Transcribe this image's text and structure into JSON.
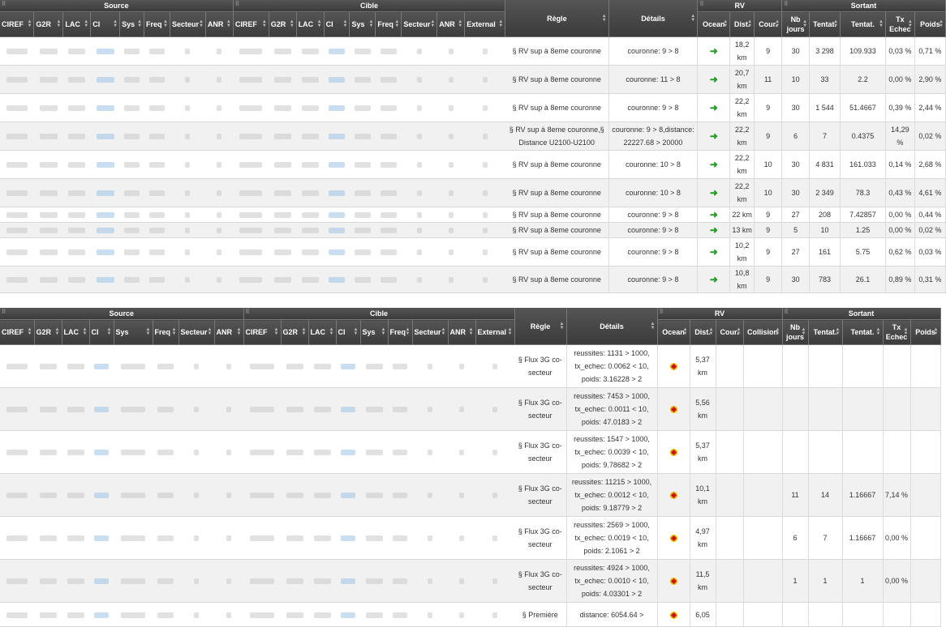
{
  "panel1": {
    "groups": {
      "source": "Source",
      "cible": "Cible",
      "rv": "RV",
      "sortant": "Sortant"
    },
    "cols": {
      "source": [
        "CIREF",
        "G2R",
        "LAC",
        "CI",
        "Sys",
        "Freq",
        "Secteur",
        "ANR"
      ],
      "cible": [
        "CIREF",
        "G2R",
        "LAC",
        "CI",
        "Sys",
        "Freq",
        "Secteur",
        "ANR",
        "External"
      ],
      "regle": "Règle",
      "details": "Détails",
      "rv": [
        "Ocean",
        "Dist.",
        "Cour."
      ],
      "sortant": [
        "Nb jours",
        "Tentat.",
        "Tentat.",
        "Tx Echec",
        "Poids"
      ]
    },
    "rows": [
      {
        "regle": "§ RV sup à 8eme couronne",
        "details": "couronne: 9 > 8",
        "dist": "18,2 km",
        "cour": "9",
        "nb": "30",
        "t1": "3 298",
        "t2": "109.933",
        "tx": "0,03 %",
        "poids": "0,71 %"
      },
      {
        "regle": "§ RV sup à 8eme couronne",
        "details": "couronne: 11 > 8",
        "dist": "20,7 km",
        "cour": "11",
        "nb": "10",
        "t1": "33",
        "t2": "2.2",
        "tx": "0,00 %",
        "poids": "2,90 %"
      },
      {
        "regle": "§ RV sup à 8eme couronne",
        "details": "couronne: 9 > 8",
        "dist": "22,2 km",
        "cour": "9",
        "nb": "30",
        "t1": "1 544",
        "t2": "51.4667",
        "tx": "0,39 %",
        "poids": "2,44 %"
      },
      {
        "regle": "§ RV sup à 8eme couronne,§ Distance U2100-U2100",
        "details": "couronne: 9 > 8,distance: 22227.68 > 20000",
        "dist": "22,2 km",
        "cour": "9",
        "nb": "6",
        "t1": "7",
        "t2": "0.4375",
        "tx": "14,29 %",
        "poids": "0,02 %"
      },
      {
        "regle": "§ RV sup à 8eme couronne",
        "details": "couronne: 10 > 8",
        "dist": "22,2 km",
        "cour": "10",
        "nb": "30",
        "t1": "4 831",
        "t2": "161.033",
        "tx": "0,14 %",
        "poids": "2,68 %"
      },
      {
        "regle": "§ RV sup à 8eme couronne",
        "details": "couronne: 10 > 8",
        "dist": "22,2 km",
        "cour": "10",
        "nb": "30",
        "t1": "2 349",
        "t2": "78.3",
        "tx": "0,43 %",
        "poids": "4,61 %"
      },
      {
        "regle": "§ RV sup à 8eme couronne",
        "details": "couronne: 9 > 8",
        "dist": "22 km",
        "cour": "9",
        "nb": "27",
        "t1": "208",
        "t2": "7.42857",
        "tx": "0,00 %",
        "poids": "0,44 %"
      },
      {
        "regle": "§ RV sup à 8eme couronne",
        "details": "couronne: 9 > 8",
        "dist": "13 km",
        "cour": "9",
        "nb": "5",
        "t1": "10",
        "t2": "1.25",
        "tx": "0,00 %",
        "poids": "0,02 %"
      },
      {
        "regle": "§ RV sup à 8eme couronne",
        "details": "couronne: 9 > 8",
        "dist": "10,2 km",
        "cour": "9",
        "nb": "27",
        "t1": "161",
        "t2": "5.75",
        "tx": "0,62 %",
        "poids": "0,03 %"
      },
      {
        "regle": "§ RV sup à 8eme couronne",
        "details": "couronne: 9 > 8",
        "dist": "10,8 km",
        "cour": "9",
        "nb": "30",
        "t1": "783",
        "t2": "26.1",
        "tx": "0,89 %",
        "poids": "0,31 %"
      }
    ]
  },
  "panel2": {
    "groups": {
      "source": "Source",
      "cible": "Cible",
      "rv": "RV",
      "sortant": "Sortant"
    },
    "cols": {
      "source": [
        "CIREF",
        "G2R",
        "LAC",
        "CI",
        "Sys",
        "Freq",
        "Secteur",
        "ANR"
      ],
      "cible": [
        "CIREF",
        "G2R",
        "LAC",
        "CI",
        "Sys",
        "Freq",
        "Secteur",
        "ANR",
        "External"
      ],
      "regle": "Règle",
      "details": "Détails",
      "rv": [
        "Ocean",
        "Dist.",
        "Cour.",
        "Collision"
      ],
      "sortant": [
        "Nb jours",
        "Tentat.",
        "Tentat.",
        "Tx Echec",
        "Poids"
      ]
    },
    "rows": [
      {
        "regle": "§ Flux 3G co-secteur",
        "details": "reussites: 1131 > 1000, tx_echec: 0.0062 < 10, poids: 3.16228 > 2",
        "dist": "5,37 km",
        "cour": "",
        "col": "",
        "nb": "",
        "t1": "",
        "t2": "",
        "tx": "",
        "poids": ""
      },
      {
        "regle": "§ Flux 3G co-secteur",
        "details": "reussites: 7453 > 1000, tx_echec: 0.0011 < 10, poids: 47.0183 > 2",
        "dist": "5,56 km",
        "cour": "",
        "col": "",
        "nb": "",
        "t1": "",
        "t2": "",
        "tx": "",
        "poids": ""
      },
      {
        "regle": "§ Flux 3G co-secteur",
        "details": "reussites: 1547 > 1000, tx_echec: 0.0039 < 10, poids: 9.78682 > 2",
        "dist": "5,37 km",
        "cour": "",
        "col": "",
        "nb": "",
        "t1": "",
        "t2": "",
        "tx": "",
        "poids": ""
      },
      {
        "regle": "§ Flux 3G co-secteur",
        "details": "reussites: 11215 > 1000, tx_echec: 0.0012 < 10, poids: 9.18779 > 2",
        "dist": "10,1 km",
        "cour": "",
        "col": "",
        "nb": "11",
        "t1": "14",
        "t2": "1.16667",
        "tx": "7,14 %",
        "poids": ""
      },
      {
        "regle": "§ Flux 3G co-secteur",
        "details": "reussites: 2569 > 1000, tx_echec: 0.0019 < 10, poids: 2.1061 > 2",
        "dist": "4,97 km",
        "cour": "",
        "col": "",
        "nb": "6",
        "t1": "7",
        "t2": "1.16667",
        "tx": "0,00 %",
        "poids": ""
      },
      {
        "regle": "§ Flux 3G co-secteur",
        "details": "reussites: 4924 > 1000, tx_echec: 0.0010 < 10, poids: 4.03301 > 2",
        "dist": "11,5 km",
        "cour": "",
        "col": "",
        "nb": "1",
        "t1": "1",
        "t2": "1",
        "tx": "0,00 %",
        "poids": ""
      },
      {
        "regle": "§ Première",
        "details": "distance: 6054.64 >",
        "dist": "6,05",
        "cour": "",
        "col": "",
        "nb": "",
        "t1": "",
        "t2": "",
        "tx": "",
        "poids": ""
      }
    ]
  }
}
